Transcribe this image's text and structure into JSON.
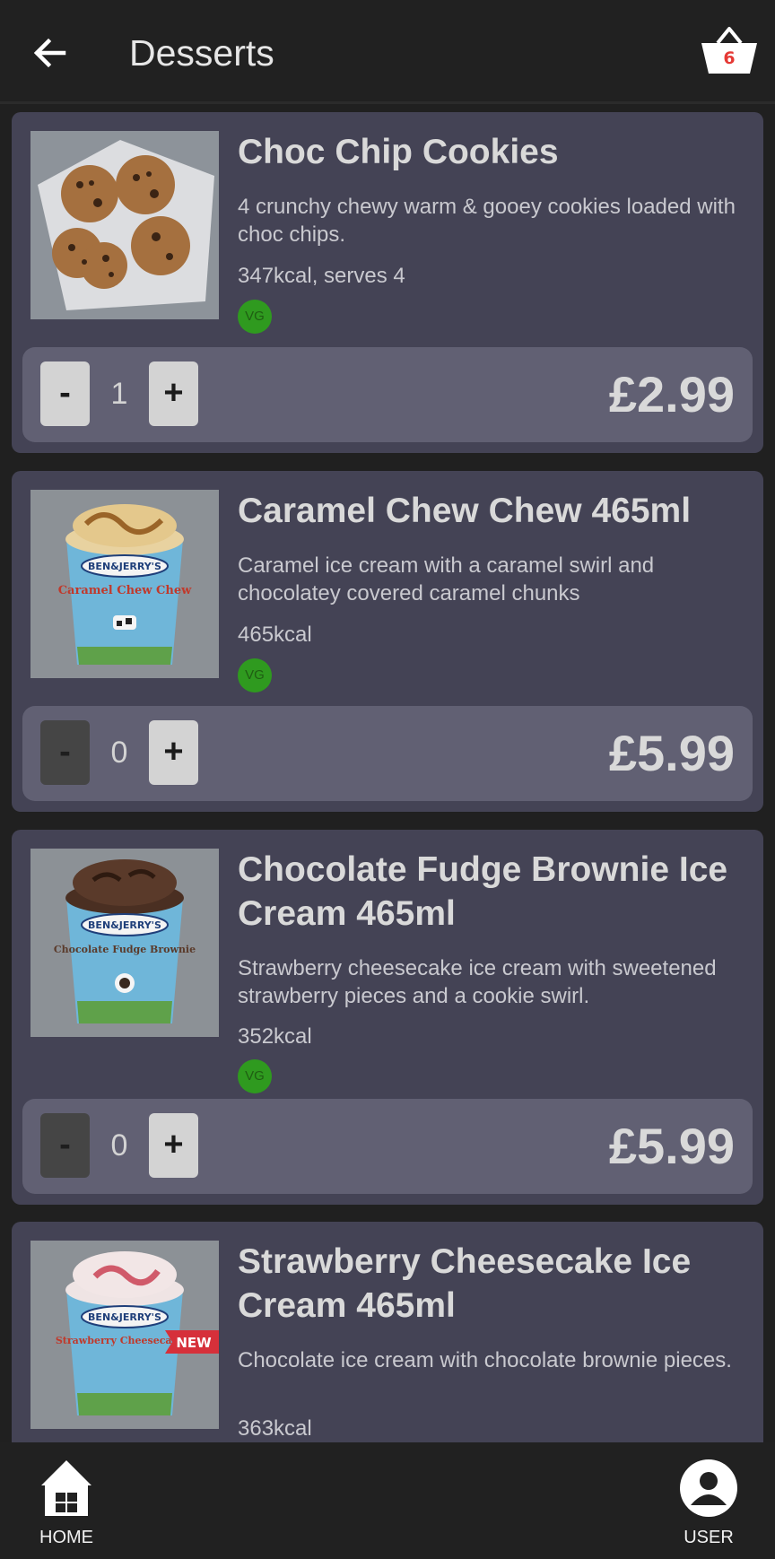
{
  "header": {
    "title": "Desserts",
    "basket_count": "6"
  },
  "products": [
    {
      "name": "Choc Chip Cookies",
      "size": "",
      "description": "4 crunchy chewy warm & gooey cookies loaded with choc chips.",
      "kcal": "347kcal, serves 4",
      "badge": "VG",
      "quantity": "1",
      "price": "£2.99",
      "minus_label": "-",
      "plus_label": "+"
    },
    {
      "name": "Caramel Chew Chew",
      "size": "465ml",
      "description": "Caramel ice cream with a caramel swirl and chocolatey covered caramel chunks",
      "kcal": "465kcal",
      "badge": "VG",
      "quantity": "0",
      "price": "£5.99",
      "minus_label": "-",
      "plus_label": "+"
    },
    {
      "name": "Chocolate Fudge Brownie Ice Cream",
      "size": "465ml",
      "description": "Strawberry cheesecake ice cream with sweetened strawberry pieces and a cookie swirl.",
      "kcal": "352kcal",
      "badge": "VG",
      "quantity": "0",
      "price": "£5.99",
      "minus_label": "-",
      "plus_label": "+"
    },
    {
      "name": "Strawberry Cheesecake Ice Cream",
      "size": "465ml",
      "description": "Chocolate ice cream with chocolate brownie pieces.",
      "kcal": "363kcal",
      "tub_brand": "BEN&JERRY'S",
      "tub_flavour": "Strawberry Cheesecake",
      "new_label": "NEW"
    }
  ],
  "tub_labels": {
    "caramel": {
      "brand": "BEN&JERRY'S",
      "flavour": "Caramel Chew Chew"
    },
    "fudge": {
      "brand": "BEN&JERRY'S",
      "flavour": "Chocolate Fudge Brownie"
    }
  },
  "bottom_nav": {
    "home_label": "HOME",
    "user_label": "USER"
  },
  "colors": {
    "background": "#202020",
    "card": "#444355",
    "qty_bar": "#616073",
    "vg_badge": "#2f9a1f",
    "basket_count": "#e53935"
  }
}
